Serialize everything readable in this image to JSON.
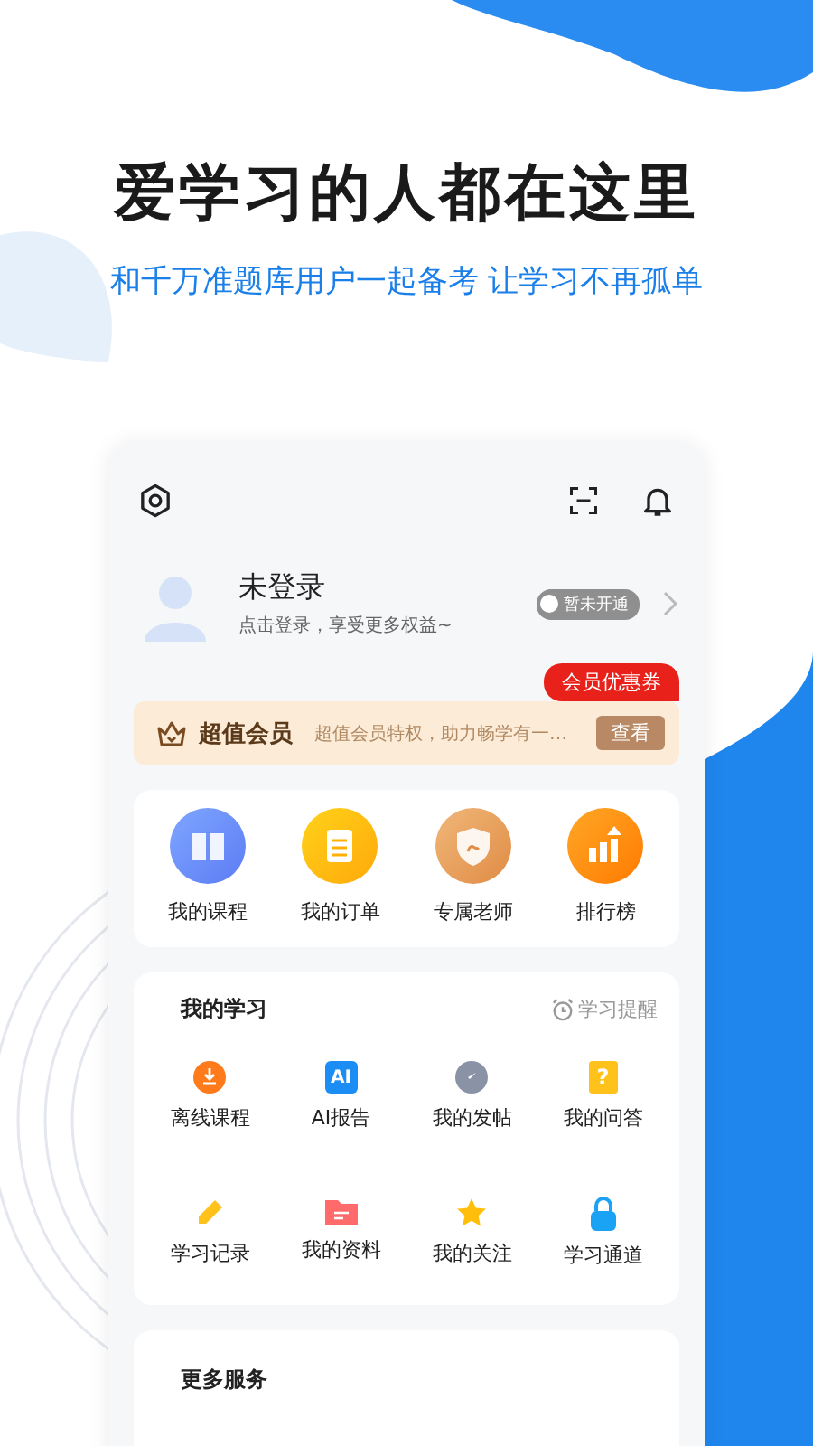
{
  "headline": "爱学习的人都在这里",
  "subtitle": "和千万准题库用户一起备考 让学习不再孤单",
  "profile": {
    "name": "未登录",
    "hint": "点击登录，享受更多权益~",
    "badge": "暂未开通",
    "coupon": "会员优惠券"
  },
  "vip": {
    "title": "超值会员",
    "desc": "超值会员特权，助力畅学有一…",
    "button": "查看"
  },
  "shortcuts": [
    {
      "kind": "course",
      "label": "我的课程"
    },
    {
      "kind": "order",
      "label": "我的订单"
    },
    {
      "kind": "teacher",
      "label": "专属老师"
    },
    {
      "kind": "rank",
      "label": "排行榜"
    }
  ],
  "study": {
    "title": "我的学习",
    "reminder": "学习提醒",
    "items": [
      {
        "kind": "download",
        "label": "离线课程"
      },
      {
        "kind": "ai",
        "icon_text": "AI",
        "label": "AI报告"
      },
      {
        "kind": "post",
        "label": "我的发帖"
      },
      {
        "kind": "qa",
        "icon_text": "?",
        "label": "我的问答"
      },
      {
        "kind": "record",
        "label": "学习记录"
      },
      {
        "kind": "files",
        "label": "我的资料"
      },
      {
        "kind": "follow",
        "label": "我的关注"
      },
      {
        "kind": "lock",
        "label": "学习通道"
      }
    ]
  },
  "more": {
    "title": "更多服务"
  }
}
